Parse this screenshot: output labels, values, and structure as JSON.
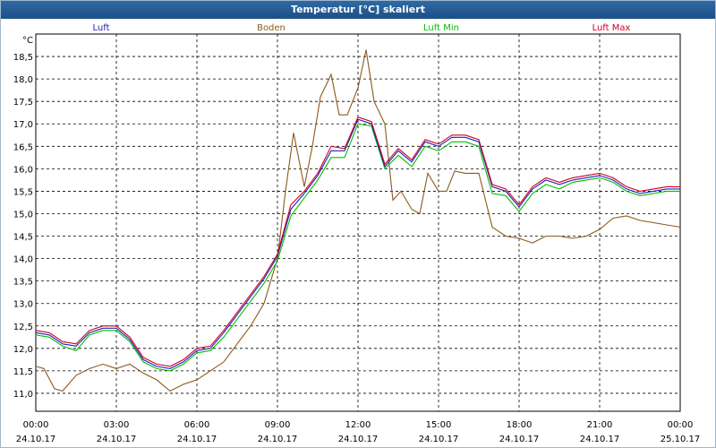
{
  "window": {
    "title": "Temperatur [°C] skaliert"
  },
  "chart_data": {
    "type": "line",
    "title": "Temperatur [°C] skaliert",
    "ylabel": "°C",
    "ylim": [
      10.6,
      19.0
    ],
    "xlim": [
      0,
      24
    ],
    "yticks": [
      "11,0",
      "11,5",
      "12,0",
      "12,5",
      "13,0",
      "13,5",
      "14,0",
      "14,5",
      "15,0",
      "15,5",
      "16,0",
      "16,5",
      "17,0",
      "17,5",
      "18,0",
      "18,5"
    ],
    "ytick_values": [
      11.0,
      11.5,
      12.0,
      12.5,
      13.0,
      13.5,
      14.0,
      14.5,
      15.0,
      15.5,
      16.0,
      16.5,
      17.0,
      17.5,
      18.0,
      18.5
    ],
    "xticks": [
      {
        "time": "00:00",
        "date": "24.10.17",
        "h": 0
      },
      {
        "time": "03:00",
        "date": "24.10.17",
        "h": 3
      },
      {
        "time": "06:00",
        "date": "24.10.17",
        "h": 6
      },
      {
        "time": "09:00",
        "date": "24.10.17",
        "h": 9
      },
      {
        "time": "12:00",
        "date": "24.10.17",
        "h": 12
      },
      {
        "time": "15:00",
        "date": "24.10.17",
        "h": 15
      },
      {
        "time": "18:00",
        "date": "24.10.17",
        "h": 18
      },
      {
        "time": "21:00",
        "date": "24.10.17",
        "h": 21
      },
      {
        "time": "00:00",
        "date": "25.10.17",
        "h": 24
      }
    ],
    "grid": true,
    "series": [
      {
        "name": "Luft",
        "color": "#2020c0",
        "x": [
          0,
          0.5,
          1,
          1.5,
          2,
          2.5,
          3,
          3.5,
          4,
          4.5,
          5,
          5.5,
          6,
          6.5,
          7,
          7.5,
          8,
          8.5,
          9,
          9.5,
          10,
          10.5,
          11,
          11.5,
          12,
          12.5,
          13,
          13.5,
          14,
          14.5,
          15,
          15.5,
          16,
          16.5,
          17,
          17.5,
          18,
          18.5,
          19,
          19.5,
          20,
          20.5,
          21,
          21.5,
          22,
          22.5,
          23,
          23.5,
          24
        ],
        "values": [
          12.35,
          12.3,
          12.1,
          12.05,
          12.35,
          12.45,
          12.45,
          12.2,
          11.75,
          11.6,
          11.55,
          11.7,
          11.95,
          12.0,
          12.35,
          12.75,
          13.15,
          13.55,
          14.05,
          15.1,
          15.45,
          15.85,
          16.4,
          16.4,
          17.1,
          17.0,
          16.05,
          16.4,
          16.15,
          16.6,
          16.5,
          16.7,
          16.7,
          16.6,
          15.6,
          15.5,
          15.15,
          15.55,
          15.75,
          15.65,
          15.75,
          15.8,
          15.85,
          15.75,
          15.55,
          15.45,
          15.5,
          15.55,
          15.55
        ]
      },
      {
        "name": "Boden",
        "color": "#8b5a1c",
        "x": [
          0,
          0.3,
          0.7,
          1,
          1.5,
          2,
          2.5,
          3,
          3.5,
          4,
          4.5,
          5,
          5.5,
          6,
          6.5,
          7,
          7.5,
          8,
          8.5,
          9,
          9.3,
          9.6,
          10,
          10.3,
          10.6,
          11,
          11.3,
          11.6,
          12,
          12.3,
          12.6,
          13,
          13.3,
          13.6,
          14,
          14.3,
          14.6,
          15,
          15.3,
          15.6,
          16,
          16.5,
          17,
          17.5,
          18,
          18.5,
          19,
          19.5,
          20,
          20.5,
          21,
          21.5,
          22,
          22.5,
          23,
          23.5,
          24
        ],
        "values": [
          11.6,
          11.55,
          11.1,
          11.05,
          11.4,
          11.55,
          11.65,
          11.55,
          11.65,
          11.45,
          11.3,
          11.05,
          11.2,
          11.3,
          11.5,
          11.7,
          12.1,
          12.5,
          13.0,
          14.0,
          15.5,
          16.8,
          15.6,
          16.5,
          17.6,
          18.1,
          17.2,
          17.2,
          17.8,
          18.65,
          17.5,
          17.0,
          15.3,
          15.5,
          15.1,
          15.0,
          15.9,
          15.5,
          15.5,
          15.95,
          15.9,
          15.9,
          14.7,
          14.5,
          14.45,
          14.35,
          14.5,
          14.5,
          14.45,
          14.5,
          14.65,
          14.9,
          14.95,
          14.85,
          14.8,
          14.75,
          14.7
        ]
      },
      {
        "name": "Luft Min",
        "color": "#00c000",
        "x": [
          0,
          0.5,
          1,
          1.5,
          2,
          2.5,
          3,
          3.5,
          4,
          4.5,
          5,
          5.5,
          6,
          6.5,
          7,
          7.5,
          8,
          8.5,
          9,
          9.5,
          10,
          10.5,
          11,
          11.5,
          12,
          12.5,
          13,
          13.5,
          14,
          14.5,
          15,
          15.5,
          16,
          16.5,
          17,
          17.5,
          18,
          18.5,
          19,
          19.5,
          20,
          20.5,
          21,
          21.5,
          22,
          22.5,
          23,
          23.5,
          24
        ],
        "values": [
          12.3,
          12.25,
          12.05,
          11.95,
          12.3,
          12.4,
          12.4,
          12.15,
          11.7,
          11.55,
          11.5,
          11.65,
          11.9,
          11.95,
          12.25,
          12.65,
          13.05,
          13.45,
          13.95,
          14.95,
          15.35,
          15.75,
          16.25,
          16.25,
          17.0,
          16.95,
          16.0,
          16.3,
          16.05,
          16.5,
          16.4,
          16.6,
          16.6,
          16.5,
          15.45,
          15.4,
          15.05,
          15.45,
          15.65,
          15.55,
          15.7,
          15.75,
          15.8,
          15.7,
          15.5,
          15.4,
          15.45,
          15.5,
          15.5
        ]
      },
      {
        "name": "Luft Max",
        "color": "#d00020",
        "x": [
          0,
          0.5,
          1,
          1.5,
          2,
          2.5,
          3,
          3.5,
          4,
          4.5,
          5,
          5.5,
          6,
          6.5,
          7,
          7.5,
          8,
          8.5,
          9,
          9.5,
          10,
          10.5,
          11,
          11.5,
          12,
          12.5,
          13,
          13.5,
          14,
          14.5,
          15,
          15.5,
          16,
          16.5,
          17,
          17.5,
          18,
          18.5,
          19,
          19.5,
          20,
          20.5,
          21,
          21.5,
          22,
          22.5,
          23,
          23.5,
          24
        ],
        "values": [
          12.4,
          12.35,
          12.15,
          12.1,
          12.4,
          12.5,
          12.5,
          12.25,
          11.8,
          11.65,
          11.6,
          11.75,
          12.0,
          12.05,
          12.4,
          12.8,
          13.2,
          13.6,
          14.1,
          15.2,
          15.5,
          15.9,
          16.5,
          16.45,
          17.15,
          17.05,
          16.1,
          16.45,
          16.2,
          16.65,
          16.55,
          16.75,
          16.75,
          16.65,
          15.65,
          15.55,
          15.2,
          15.6,
          15.8,
          15.7,
          15.8,
          15.85,
          15.9,
          15.8,
          15.6,
          15.5,
          15.55,
          15.6,
          15.6
        ]
      }
    ]
  }
}
